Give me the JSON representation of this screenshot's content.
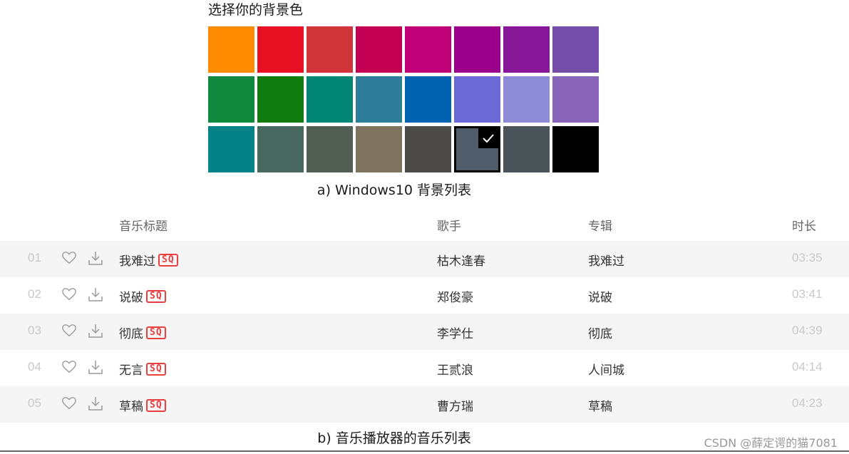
{
  "palette": {
    "title": "选择你的背景色",
    "swatches": [
      "#ff8c00",
      "#e81123",
      "#d13438",
      "#c30052",
      "#bf0077",
      "#9a0089",
      "#881798",
      "#744da9",
      "#10893e",
      "#107c10",
      "#018574",
      "#2d7d9a",
      "#0063b1",
      "#6b69d6",
      "#8e8cd8",
      "#8764b8",
      "#038387",
      "#486860",
      "#525e54",
      "#7e735f",
      "#4c4a48",
      "#515c6b",
      "#4a5459",
      "#000000"
    ],
    "selected_index": 21,
    "caption": "a) Windows10 背景列表"
  },
  "music": {
    "headers": {
      "title": "音乐标题",
      "singer": "歌手",
      "album": "专辑",
      "duration": "时长"
    },
    "rows": [
      {
        "index": "01",
        "title": "我难过",
        "badge": "SQ",
        "singer": "枯木逢春",
        "album": "我难过",
        "duration": "03:35"
      },
      {
        "index": "02",
        "title": "说破",
        "badge": "SQ",
        "singer": "郑俊豪",
        "album": "说破",
        "duration": "03:41"
      },
      {
        "index": "03",
        "title": "彻底",
        "badge": "SQ",
        "singer": "李学仕",
        "album": "彻底",
        "duration": "04:39"
      },
      {
        "index": "04",
        "title": "无言",
        "badge": "SQ",
        "singer": "王贰浪",
        "album": "人间城",
        "duration": "04:14"
      },
      {
        "index": "05",
        "title": "草稿",
        "badge": "SQ",
        "singer": "曹方瑞",
        "album": "草稿",
        "duration": "04:23"
      }
    ],
    "caption": "b) 音乐播放器的音乐列表"
  },
  "watermark": "CSDN @薛定谔的猫7081"
}
